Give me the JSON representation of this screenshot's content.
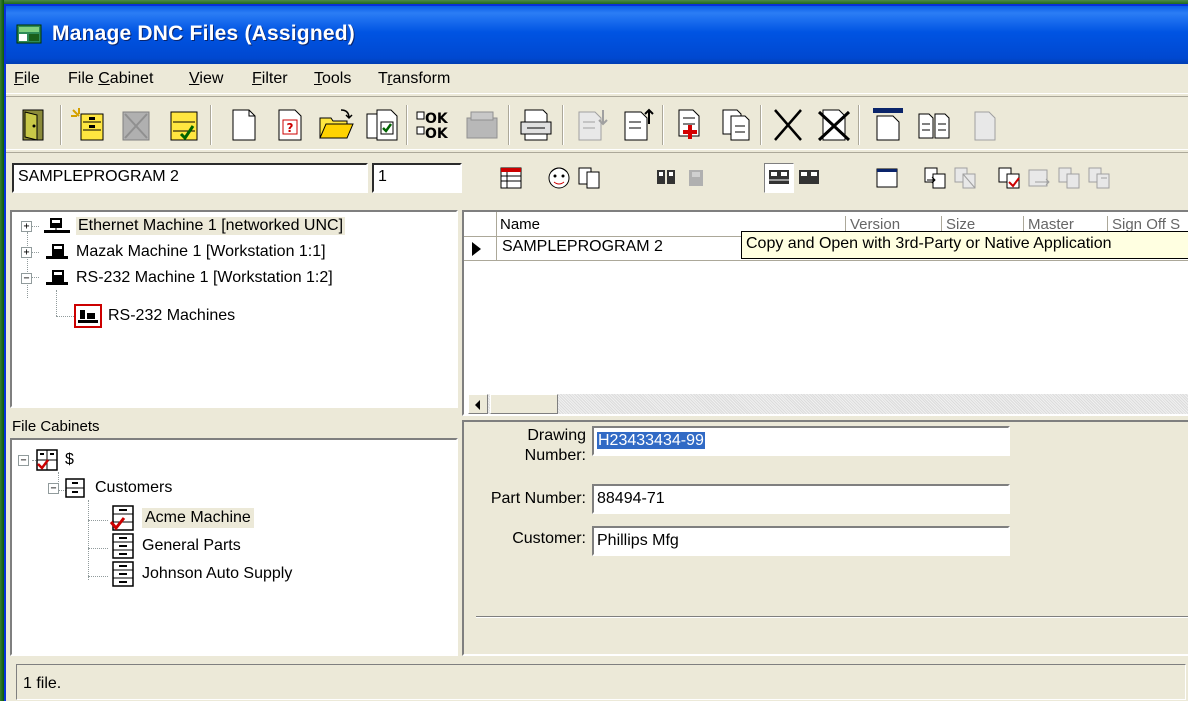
{
  "window": {
    "title": "Manage DNC Files (Assigned)"
  },
  "menu": {
    "items": [
      {
        "label": "File"
      },
      {
        "label": "File Cabinet"
      },
      {
        "label": "View"
      },
      {
        "label": "Filter"
      },
      {
        "label": "Tools"
      },
      {
        "label": "Transform"
      }
    ]
  },
  "toolbar2": {
    "program_name": "SAMPLEPROGRAM 2",
    "version": "1"
  },
  "machine_tree": {
    "items": [
      {
        "label": "Ethernet Machine 1 [networked UNC]"
      },
      {
        "label": "Mazak Machine 1 [Workstation 1:1]"
      },
      {
        "label": "RS-232 Machine 1 [Workstation 1:2]"
      },
      {
        "label": "RS-232 Machines"
      }
    ]
  },
  "file_cabinets": {
    "label": "File Cabinets",
    "root": "$",
    "folder": "Customers",
    "items": [
      {
        "label": "Acme Machine"
      },
      {
        "label": "General Parts"
      },
      {
        "label": "Johnson Auto Supply"
      }
    ]
  },
  "grid": {
    "columns": [
      {
        "label": "Name"
      },
      {
        "label": "Version"
      },
      {
        "label": "Size"
      },
      {
        "label": "Master"
      },
      {
        "label": "Sign Off S"
      }
    ],
    "rows": [
      {
        "name": "SAMPLEPROGRAM 2"
      }
    ]
  },
  "tooltip": {
    "text": "Copy and Open with 3rd-Party or Native Application"
  },
  "details": {
    "drawing_number_label_1": "Drawing",
    "drawing_number_label_2": "Number:",
    "drawing_number": "H23433434-99",
    "part_number_label": "Part Number:",
    "part_number": "88494-71",
    "customer_label": "Customer:",
    "customer": "Phillips Mfg"
  },
  "status": {
    "text": "1 file."
  },
  "colors": {
    "titlebar": "#0054e3",
    "selection": "#316ac5",
    "tooltip": "#ffffe1"
  }
}
